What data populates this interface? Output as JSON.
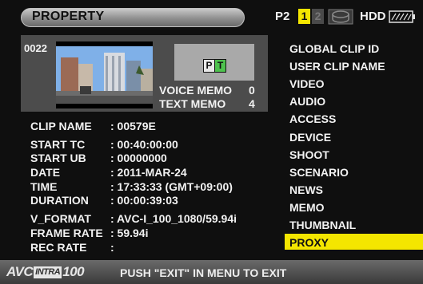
{
  "header": {
    "title": "PROPERTY",
    "p2_label": "P2",
    "slot1": "1",
    "slot2": "2",
    "hdd_label": "HDD"
  },
  "clip": {
    "number": "0022",
    "pt_p": "P",
    "pt_t": "T",
    "voice_memo_label": "VOICE MEMO",
    "voice_memo_value": "0",
    "text_memo_label": "TEXT MEMO",
    "text_memo_value": "4"
  },
  "info": [
    {
      "label": "CLIP NAME",
      "value": ": 00579E"
    },
    {
      "label": "START TC",
      "value": ": 00:40:00:00"
    },
    {
      "label": "START UB",
      "value": ": 00000000"
    },
    {
      "label": "DATE",
      "value": ": 2011-MAR-24"
    },
    {
      "label": "TIME",
      "value": ": 17:33:33 (GMT+09:00)"
    },
    {
      "label": "DURATION",
      "value": ": 00:00:39:03"
    },
    {
      "label": "V_FORMAT",
      "value": ": AVC-I_100_1080/59.94i"
    },
    {
      "label": "FRAME RATE",
      "value": ": 59.94i"
    },
    {
      "label": "REC RATE",
      "value": ":"
    }
  ],
  "menu": [
    {
      "label": "GLOBAL CLIP ID"
    },
    {
      "label": "USER CLIP NAME"
    },
    {
      "label": "VIDEO"
    },
    {
      "label": "AUDIO"
    },
    {
      "label": "ACCESS"
    },
    {
      "label": "DEVICE"
    },
    {
      "label": "SHOOT"
    },
    {
      "label": "SCENARIO"
    },
    {
      "label": "NEWS"
    },
    {
      "label": "MEMO"
    },
    {
      "label": "THUMBNAIL"
    },
    {
      "label": "PROXY",
      "selected": true
    }
  ],
  "footer": {
    "logo_avc": "AVC",
    "logo_intra": "INTRA",
    "logo_100": "100",
    "message": "PUSH \"EXIT\" IN MENU TO EXIT"
  },
  "colors": {
    "highlight": "#f4e600",
    "background": "#0f0f0f",
    "panel": "#4c4c4c",
    "text_green": "#4ec24e"
  }
}
